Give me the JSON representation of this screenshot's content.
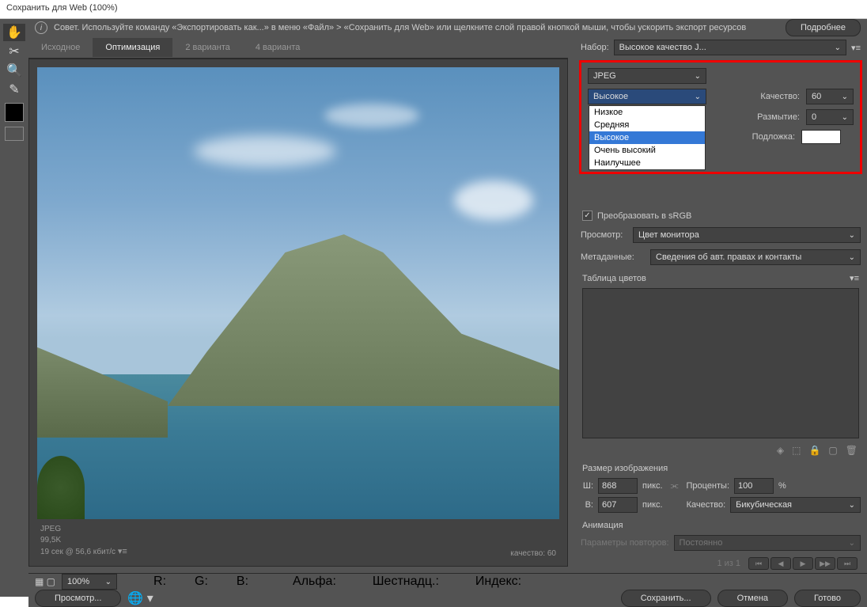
{
  "title": "Сохранить для Web (100%)",
  "tip": "Совет. Используйте команду «Экспортировать как...» в меню «Файл» > «Сохранить для Web» или щелкните слой правой кнопкой мыши, чтобы ускорить экспорт ресурсов",
  "more_btn": "Подробнее",
  "tabs": [
    "Исходное",
    "Оптимизация",
    "2 варианта",
    "4 варианта"
  ],
  "preset_label": "Набор:",
  "preset_value": "Высокое качество J...",
  "format": "JPEG",
  "quality_dropdown": "Высокое",
  "quality_options": [
    "Низкое",
    "Средняя",
    "Высокое",
    "Очень высокий",
    "Наилучшее"
  ],
  "quality_label": "Качество:",
  "quality_value": "60",
  "blur_label": "Размытие:",
  "blur_value": "0",
  "matte_label": "Подложка:",
  "srgb_label": "Преобразовать в sRGB",
  "preview_label": "Просмотр:",
  "preview_value": "Цвет монитора",
  "metadata_label": "Метаданные:",
  "metadata_value": "Сведения об авт. правах и контакты",
  "color_table_title": "Таблица цветов",
  "image_size_title": "Размер изображения",
  "w_label": "Ш:",
  "w_value": "868",
  "h_label": "В:",
  "h_value": "607",
  "px_label": "пикс.",
  "percent_label": "Проценты:",
  "percent_value": "100",
  "pct_sign": "%",
  "resample_label": "Качество:",
  "resample_value": "Бикубическая",
  "anim_title": "Анимация",
  "loop_label": "Параметры повторов:",
  "loop_value": "Постоянно",
  "frame_info": "1 из 1",
  "info_format": "JPEG",
  "info_size": "99,5K",
  "info_time": "19 сек @ 56,6 кбит/с",
  "info_quality": "качество: 60",
  "zoom": "100%",
  "readout_r": "R:",
  "readout_g": "G:",
  "readout_b": "B:",
  "readout_alpha": "Альфа:",
  "readout_hex": "Шестнадц.:",
  "readout_index": "Индекс:",
  "btn_preview": "Просмотр...",
  "btn_save": "Сохранить...",
  "btn_cancel": "Отмена",
  "btn_done": "Готово"
}
